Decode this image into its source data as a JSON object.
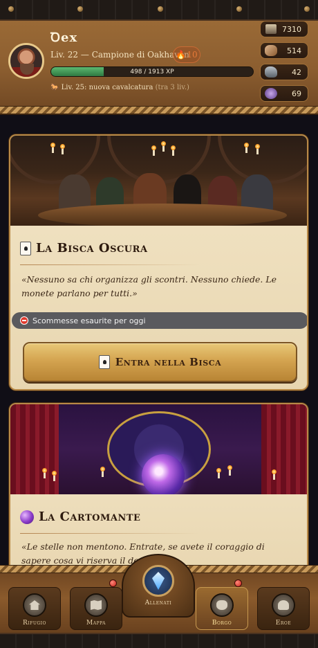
{
  "player": {
    "name": "Ꝺex",
    "level_line": "Liv. 22 — Campione di Oakhaven",
    "streak": "10",
    "xp_text": "498 / 1913 XP",
    "xp_progress": 0.26,
    "next_level_text": "Liv. 25: nuova cavalcatura",
    "next_level_hint": "(tra 3 liv.)"
  },
  "resources": [
    {
      "icon": "gold-chest-icon",
      "value": "7310"
    },
    {
      "icon": "wood-icon",
      "value": "514"
    },
    {
      "icon": "stone-icon",
      "value": "42"
    },
    {
      "icon": "gem-icon",
      "value": "69"
    }
  ],
  "cards": [
    {
      "title": "La Bisca Oscura",
      "quote": "«Nessuno sa chi organizza gli scontri. Nessuno chiede. Le monete parlano per tutti.»",
      "warning": "Scommesse esaurite per oggi",
      "button": "Entra nella Bisca"
    },
    {
      "title": "La Cartomante",
      "quote": "«Le stelle non mentono. Entrate, se avete il coraggio di sapere cosa vi riserva il destino.»"
    }
  ],
  "nav": {
    "tabs": [
      {
        "label": "Rifugio",
        "icon": "house-icon"
      },
      {
        "label": "Mappa",
        "icon": "map-icon"
      },
      {
        "label": "Allenati",
        "icon": "crystal-icon"
      },
      {
        "label": "Borgo",
        "icon": "bag-icon"
      },
      {
        "label": "Eroe",
        "icon": "helmet-icon"
      }
    ],
    "active": "Borgo"
  },
  "colors": {
    "accent_gold": "#d4a450",
    "xp_green": "#4aa864",
    "warning_grey": "#5a5a5e",
    "notify_red": "#c8201a"
  }
}
